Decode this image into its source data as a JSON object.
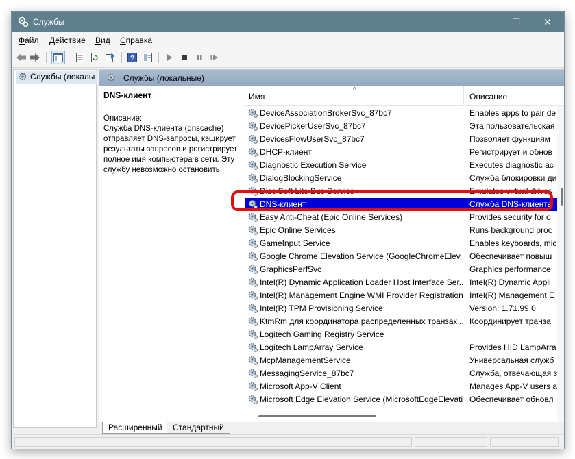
{
  "window": {
    "title": "Службы",
    "controls": {
      "minimize": "—",
      "maximize": "☐",
      "close": "✕"
    }
  },
  "menu": [
    {
      "label": "Файл",
      "accel": "Ф",
      "rest": "айл"
    },
    {
      "label": "Действие",
      "accel": "Д",
      "rest": "ействие"
    },
    {
      "label": "Вид",
      "accel": "В",
      "rest": "ид"
    },
    {
      "label": "Справка",
      "accel": "С",
      "rest": "правка"
    }
  ],
  "toolbar": {
    "icons": [
      "back-arrow-icon",
      "forward-arrow-icon",
      "show-hide-console-tree-icon",
      "properties-icon",
      "refresh-icon",
      "export-list-icon",
      "help-icon",
      "help-topics-icon",
      "start-service-icon",
      "stop-service-icon",
      "pause-service-icon",
      "restart-service-icon"
    ]
  },
  "tree": {
    "item": "Службы (локалы"
  },
  "pane": {
    "header": "Службы (локальные)",
    "selected_title": "DNS-клиент",
    "description_label": "Описание:",
    "description": "Служба DNS-клиента (dnscache) отправляет DNS-запросы, кэширует результаты запросов и регистрирует полное имя компьютера в сети. Эту службу невозможно остановить."
  },
  "list": {
    "columns": {
      "name": "Имя",
      "description": "Описание",
      "sort": "^"
    },
    "rows": [
      {
        "name": "DeviceAssociationBrokerSvc_87bc7",
        "desc": "Enables apps to pair de"
      },
      {
        "name": "DevicePickerUserSvc_87bc7",
        "desc": "Эта пользовательская"
      },
      {
        "name": "DevicesFlowUserSvc_87bc7",
        "desc": "Позволяет функциям"
      },
      {
        "name": "DHCP-клиент",
        "desc": "Регистрирует и обнов"
      },
      {
        "name": "Diagnostic Execution Service",
        "desc": "Executes diagnostic ac"
      },
      {
        "name": "DialogBlockingService",
        "desc": "Служба блокировки ди"
      },
      {
        "name": "Disc Soft Lite Bus Service",
        "desc": "Emulates virtual drives"
      },
      {
        "name": "DNS-клиент",
        "desc": "Служба DNS-клиента"
      },
      {
        "name": "Easy Anti-Cheat (Epic Online Services)",
        "desc": "Provides security for o"
      },
      {
        "name": "Epic Online Services",
        "desc": "Runs background proc"
      },
      {
        "name": "GameInput Service",
        "desc": "Enables keyboards, mic"
      },
      {
        "name": "Google Chrome Elevation Service (GoogleChromeElev...",
        "desc": "Обеспечивает повыш"
      },
      {
        "name": "GraphicsPerfSvc",
        "desc": "Graphics performance"
      },
      {
        "name": "Intel(R) Dynamic Application Loader Host Interface Ser...",
        "desc": "Intel(R) Dynamic Appli"
      },
      {
        "name": "Intel(R) Management Engine WMI Provider Registration",
        "desc": "Intel(R) Management E"
      },
      {
        "name": "Intel(R) TPM Provisioning Service",
        "desc": "Version: 1.71.99.0"
      },
      {
        "name": "KtmRm для координатора распределенных транзак...",
        "desc": "Координирует транза"
      },
      {
        "name": "Logitech Gaming Registry Service",
        "desc": ""
      },
      {
        "name": "Logitech LampArray Service",
        "desc": "Provides HID LampArra"
      },
      {
        "name": "McpManagementService",
        "desc": "Универсальная служб"
      },
      {
        "name": "MessagingService_87bc7",
        "desc": "Служба, отвечающая з"
      },
      {
        "name": "Microsoft App-V Client",
        "desc": "Manages App-V users a"
      },
      {
        "name": "Microsoft Edge Elevation Service (MicrosoftEdgeElevati...",
        "desc": "Обеспечивает обновл"
      }
    ],
    "selected_index": 7
  },
  "tabs": [
    {
      "label": "Расширенный",
      "active": true
    },
    {
      "label": "Стандартный",
      "active": false
    }
  ],
  "colors": {
    "titlebar": "#5f7f8d",
    "selection": "#0000d8",
    "highlight": "#e20d0d",
    "pane_header": "#a8bcd1"
  }
}
